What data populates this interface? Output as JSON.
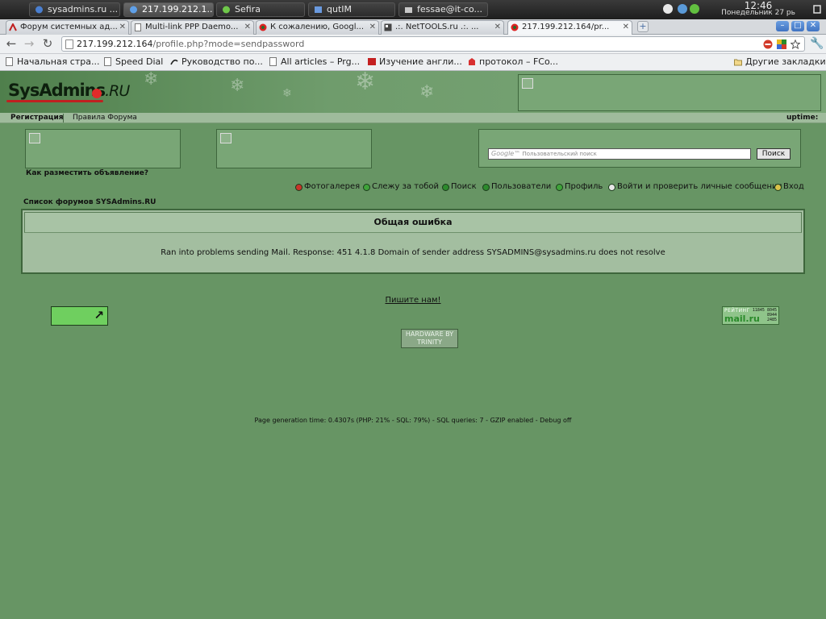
{
  "system_panel": {
    "tasks": [
      {
        "label": "sysadmins.ru ...",
        "active": false
      },
      {
        "label": "217.199.212.1...",
        "active": true
      },
      {
        "label": "Sefira",
        "active": false
      },
      {
        "label": "qutIM",
        "active": false
      },
      {
        "label": "fessae@it-co...",
        "active": false
      }
    ],
    "clock_time": "12:46",
    "clock_date": "Понедельник 27 рь"
  },
  "tabs": [
    {
      "label": "Форум системных ад..."
    },
    {
      "label": "Multi-link PPP Daemo..."
    },
    {
      "label": "К сожалению, Googl..."
    },
    {
      "label": ".:. NetTOOLS.ru .:. ..."
    },
    {
      "label": "217.199.212.164/pr..."
    }
  ],
  "toolbar": {
    "url_host": "217.199.212.164",
    "url_path": "/profile.php?mode=sendpassword"
  },
  "bookmarks": [
    {
      "label": "Начальная стра..."
    },
    {
      "label": "Speed Dial"
    },
    {
      "label": "Руководство по..."
    },
    {
      "label": "All articles – Prg..."
    },
    {
      "label": "Изучение англи..."
    },
    {
      "label": "протокол – FCo..."
    }
  ],
  "other_bookmarks": "Другие закладки",
  "site": {
    "logo_main": "SysAdmins",
    "logo_ru": ".RU",
    "menu": {
      "register": "Регистрация",
      "rules": "Правила Форума",
      "uptime": "uptime:"
    },
    "ad_question": "Как разместить объявление?",
    "search_placeholder": "Пользовательский поиск",
    "search_google": "Google™",
    "search_button": "Поиск",
    "nav_links": [
      {
        "label": "Фотогалерея",
        "color": "#c8342a"
      },
      {
        "label": "Слежу за тобой",
        "color": "#3fa33a"
      },
      {
        "label": "Поиск",
        "color": "#2d8a2d"
      },
      {
        "label": "Пользователи",
        "color": "#2d8a2d"
      },
      {
        "label": "Профиль",
        "color": "#3fa33a"
      },
      {
        "label": "Войти и проверить личные сообщения",
        "color": "#e8e8e8"
      },
      {
        "label": "Вход",
        "color": "#d9c24a"
      }
    ],
    "forum_index": "Список форумов SYSAdmins.RU",
    "error_title": "Общая ошибка",
    "error_message": "Ran into problems sending Mail. Response: 451 4.1.8 Domain of sender address SYSADMINS@sysadmins.ru does not resolve",
    "write_us": "Пишите нам!",
    "counter": {
      "top": "РЕЙТИНГ",
      "brand": "mail.ru",
      "n1": "11845 8045",
      "n2": "8944",
      "n3": "2485"
    },
    "hw_line1": "HARDWARE BY",
    "hw_line2": "TRINITY",
    "generation": "Page generation time: 0.4307s (PHP: 21% - SQL: 79%) - SQL queries: 7 - GZIP enabled - Debug off"
  }
}
